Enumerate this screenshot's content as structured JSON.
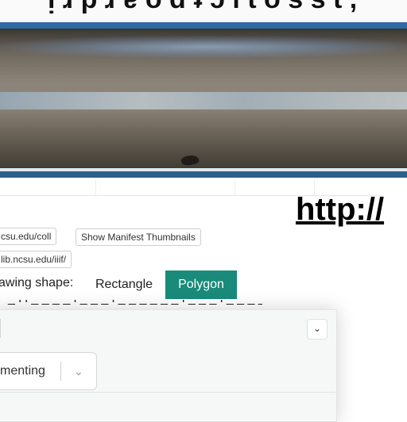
{
  "heading_fragment": "http://",
  "top_fragment": "ᴉ ɹ p ɹ ɐ o d ʇ ɔ l t o s  s t ,",
  "pills": {
    "iiif_url_1": "csu.edu/coll",
    "show_manifest_button": "Show Manifest Thumbnails",
    "iiif_url_2": "lib.ncsu.edu/iiif/"
  },
  "drawing_shape": {
    "label": "awing shape:",
    "rectangle": "Rectangle",
    "polygon": "Polygon"
  },
  "partial_text": "_ l l _ _ _ _ l _ _ _ l _ _ _ _ _ _ l _ _ _ l _ _ _ _ _",
  "panel": {
    "select_value": "menting",
    "chevron_icon": "chevron-down-icon"
  },
  "colors": {
    "accent": "#1a8a7a",
    "frame_blue": "#2f6aa6"
  }
}
